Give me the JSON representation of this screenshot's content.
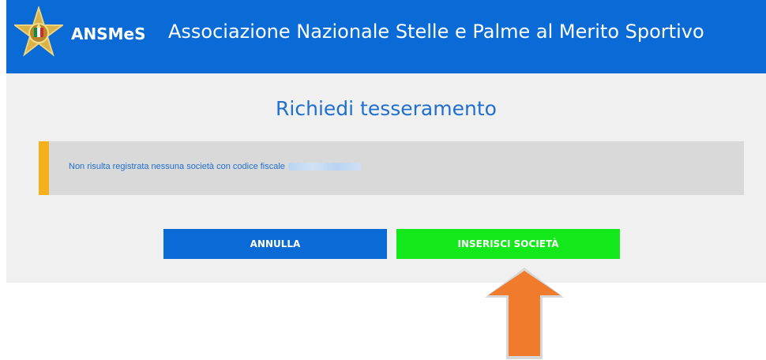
{
  "header": {
    "brand": "ANSMeS",
    "title": "Associazione Nazionale Stelle e Palme al Merito Sportivo"
  },
  "main": {
    "title": "Richiedi tesseramento",
    "alert_text": "Non risulta registrata nessuna società con codice fiscale"
  },
  "actions": {
    "cancel_label": "ANNULLA",
    "insert_label": "INSERISCI SOCIETÀ"
  },
  "colors": {
    "header_bg": "#0a6bd6",
    "accent_blue": "#1f6fcf",
    "alert_bar": "#f5b11d",
    "insert_button": "#12e81a",
    "arrow": "#f07b2c"
  },
  "icons": {
    "logo": "star-emblem-icon",
    "pointer": "up-arrow-icon"
  }
}
